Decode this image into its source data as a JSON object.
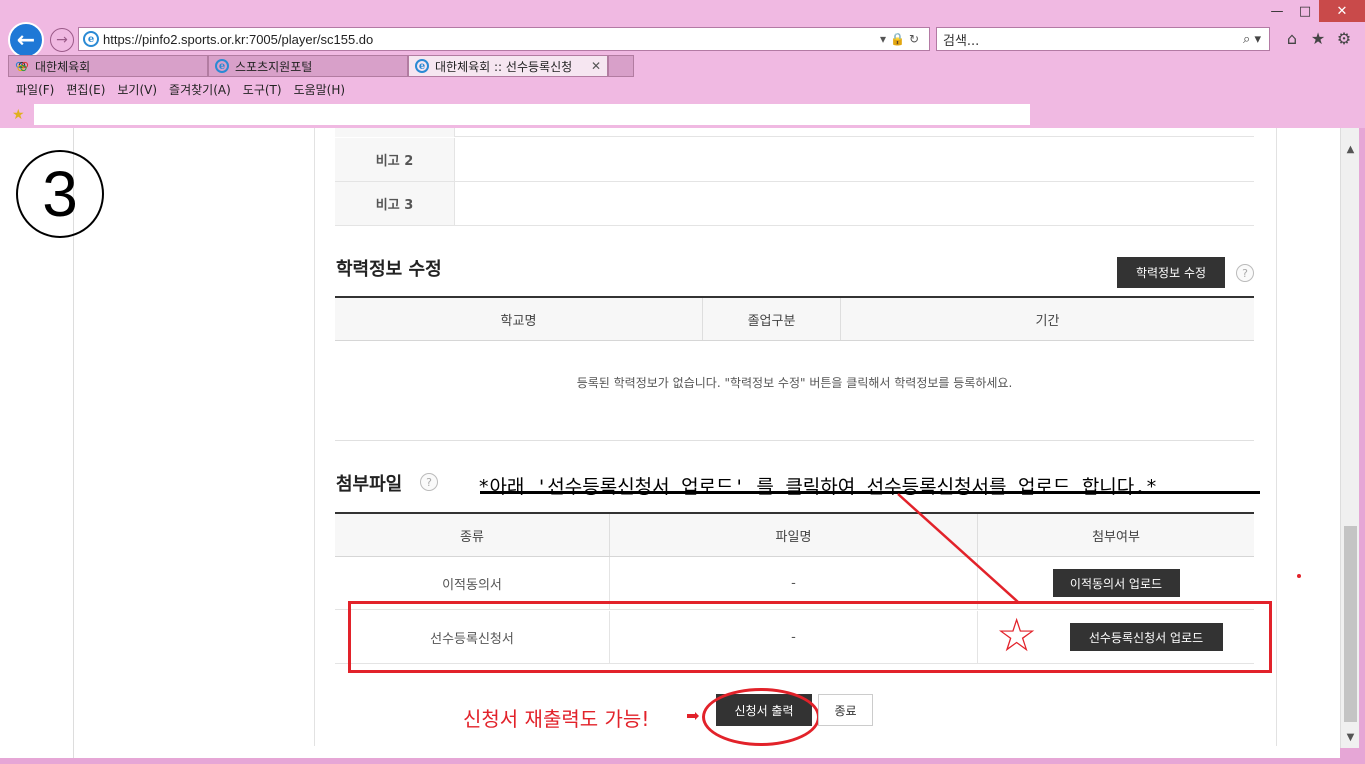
{
  "browser": {
    "url": "https://pinfo2.sports.or.kr:7005/player/sc155.do",
    "search_placeholder": "검색...",
    "tabs": [
      {
        "label": "대한체육회"
      },
      {
        "label": "스포츠지원포털"
      },
      {
        "label": "대한체육회 :: 선수등록신청"
      }
    ],
    "menu": [
      "파일(F)",
      "편집(E)",
      "보기(V)",
      "즐겨찾기(A)",
      "도구(T)",
      "도움말(H)"
    ],
    "window_controls": {
      "minimize": "—",
      "maximize": "□",
      "close": "✕"
    },
    "icons": {
      "home": "⌂",
      "favorites": "★",
      "settings": "⚙"
    }
  },
  "page": {
    "step_marker": "3",
    "notes": [
      {
        "label": "비고 2",
        "value": ""
      },
      {
        "label": "비고 3",
        "value": ""
      }
    ],
    "education": {
      "title": "학력정보 수정",
      "edit_button": "학력정보 수정",
      "columns": [
        "학교명",
        "졸업구분",
        "기간"
      ],
      "empty_message": "등록된 학력정보가 없습니다. \"학력정보 수정\" 버튼을 클릭해서 학력정보를 등록하세요."
    },
    "attachments": {
      "title": "첨부파일",
      "instruction": "*아래 '선수등록신청서 업로드' 를 클릭하여 선수등록신청서를 업로드 합니다.*",
      "columns": [
        "종류",
        "파일명",
        "첨부여부"
      ],
      "rows": [
        {
          "type": "이적동의서",
          "filename": "-",
          "button": "이적동의서 업로드"
        },
        {
          "type": "선수등록신청서",
          "filename": "-",
          "button": "선수등록신청서 업로드"
        }
      ]
    },
    "reprint_note": "신청서 재출력도 가능!",
    "print_button": "신청서 출력",
    "close_button": "종료",
    "help_glyph": "?",
    "annotation_colors": {
      "red": "#e2222a"
    }
  }
}
